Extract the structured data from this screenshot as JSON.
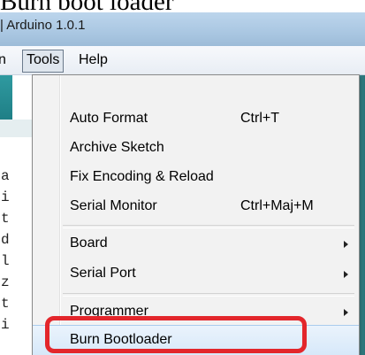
{
  "caption": "Burn boot loader",
  "window": {
    "title": "| Arduino 1.0.1"
  },
  "menubar": {
    "partial_label": "n",
    "tools_label": "Tools",
    "help_label": "Help"
  },
  "editor": {
    "line_chars": [
      "a",
      "i",
      "t",
      "d",
      "l",
      "z",
      "t",
      "i"
    ]
  },
  "tools_menu": {
    "auto_format": {
      "label": "Auto Format",
      "shortcut": "Ctrl+T"
    },
    "archive_sketch": {
      "label": "Archive Sketch"
    },
    "fix_encoding": {
      "label": "Fix Encoding & Reload"
    },
    "serial_monitor": {
      "label": "Serial Monitor",
      "shortcut": "Ctrl+Maj+M"
    },
    "board": {
      "label": "Board"
    },
    "serial_port": {
      "label": "Serial Port"
    },
    "programmer": {
      "label": "Programmer"
    },
    "burn_bootloader": {
      "label": "Burn Bootloader"
    }
  },
  "colors": {
    "annotation": "#e3262b",
    "menu_bg": "#f2f2f2",
    "titlebar": "#aac7e2"
  }
}
